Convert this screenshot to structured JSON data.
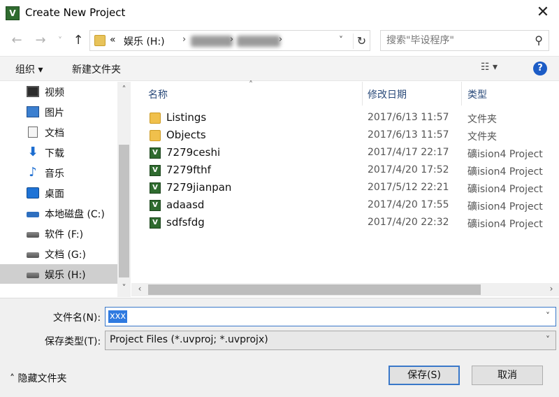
{
  "window": {
    "icon": "V",
    "title": "Create New Project",
    "close_glyph": "✕"
  },
  "nav": {
    "back_glyph": "←",
    "forward_glyph": "→",
    "dropdown_glyph": "˅",
    "up_glyph": "↑"
  },
  "address": {
    "overflow": "«",
    "drive": "娱乐 (H:)",
    "separator": "›",
    "dropdown": "˅",
    "refresh_glyph": "↻"
  },
  "search": {
    "placeholder": "搜索\"毕设程序\"",
    "icon_glyph": "⚲"
  },
  "toolbar": {
    "organize": "组织 ▾",
    "new_folder": "新建文件夹",
    "view_glyph": "☷ ▾",
    "help_glyph": "?"
  },
  "sidebar": {
    "items": [
      {
        "label": "视频",
        "icon": "video-icon"
      },
      {
        "label": "图片",
        "icon": "pictures-icon"
      },
      {
        "label": "文档",
        "icon": "documents-icon"
      },
      {
        "label": "下载",
        "icon": "download-icon",
        "glyph": "⬇"
      },
      {
        "label": "音乐",
        "icon": "music-icon",
        "glyph": "♪"
      },
      {
        "label": "桌面",
        "icon": "desktop-icon"
      },
      {
        "label": "本地磁盘 (C:)",
        "icon": "local-disk-icon"
      },
      {
        "label": "软件 (F:)",
        "icon": "drive-icon"
      },
      {
        "label": "文档 (G:)",
        "icon": "drive-icon"
      },
      {
        "label": "娱乐 (H:)",
        "icon": "drive-icon",
        "selected": true
      }
    ],
    "scroll_up": "˄",
    "scroll_down": "˅"
  },
  "columns": {
    "name": "名称",
    "date": "修改日期",
    "type": "类型",
    "sort_indicator": "˄"
  },
  "files": [
    {
      "name": "Listings",
      "date": "2017/6/13 11:57",
      "type": "文件夹",
      "icon": "folder-icon"
    },
    {
      "name": "Objects",
      "date": "2017/6/13 11:57",
      "type": "文件夹",
      "icon": "folder-icon"
    },
    {
      "name": "7279ceshi",
      "date": "2017/4/17 22:17",
      "type": "礦ision4 Project",
      "icon": "uvision-project-icon"
    },
    {
      "name": "7279fthf",
      "date": "2017/4/20 17:52",
      "type": "礦ision4 Project",
      "icon": "uvision-project-icon"
    },
    {
      "name": "7279jianpan",
      "date": "2017/5/12 22:21",
      "type": "礦ision4 Project",
      "icon": "uvision-project-icon"
    },
    {
      "name": "adaasd",
      "date": "2017/4/20 17:55",
      "type": "礦ision4 Project",
      "icon": "uvision-project-icon"
    },
    {
      "name": "sdfsfdg",
      "date": "2017/4/20 22:32",
      "type": "礦ision4 Project",
      "icon": "uvision-project-icon"
    }
  ],
  "hscroll": {
    "left": "‹",
    "right": "›"
  },
  "form": {
    "filename_label": "文件名(N):",
    "filename_value": "xxx",
    "filetype_label": "保存类型(T):",
    "filetype_value": "Project Files (*.uvproj; *.uvprojx)",
    "dropdown": "˅",
    "hide_folders": "˄ 隐藏文件夹",
    "save": "保存(S)",
    "cancel": "取消"
  }
}
